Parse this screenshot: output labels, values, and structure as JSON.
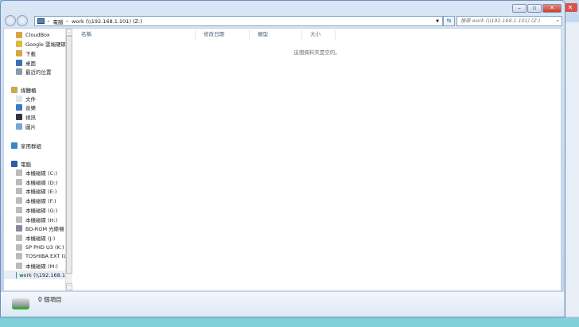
{
  "window": {
    "minimize": "–",
    "maximize": "▫",
    "close": "✕"
  },
  "address": {
    "crumbs": [
      "電腦",
      "work (\\\\192.168.1.101) (Z:)"
    ]
  },
  "search": {
    "placeholder": "搜尋 work (\\\\192.168.1.101) (Z:)"
  },
  "nav": {
    "favorites": [
      "CloudBox",
      "Google 雲端硬碟",
      "下載",
      "桌面",
      "最近的位置"
    ],
    "libraries": {
      "title": "媒體櫃",
      "items": [
        "文件",
        "音樂",
        "視訊",
        "圖片"
      ]
    },
    "homegroup": "家用群組",
    "computer": {
      "title": "電腦",
      "items": [
        "本機磁碟 (C:)",
        "本機磁碟 (D:)",
        "本機磁碟 (E:)",
        "本機磁碟 (F:)",
        "本機磁碟 (G:)",
        "本機磁碟 (H:)",
        "BD-ROM 光碟機",
        "本機磁碟 (J:)",
        "SP PHD U3 (K:)",
        "TOSHIBA EXT (L:)",
        "本機磁碟 (M:)",
        "work (\\\\192.168.1"
      ]
    }
  },
  "columns": [
    "名稱",
    "修改日期",
    "類型",
    "大小"
  ],
  "empty_message": "這個資料夾是空的。",
  "details": {
    "count": "0 個項目"
  }
}
